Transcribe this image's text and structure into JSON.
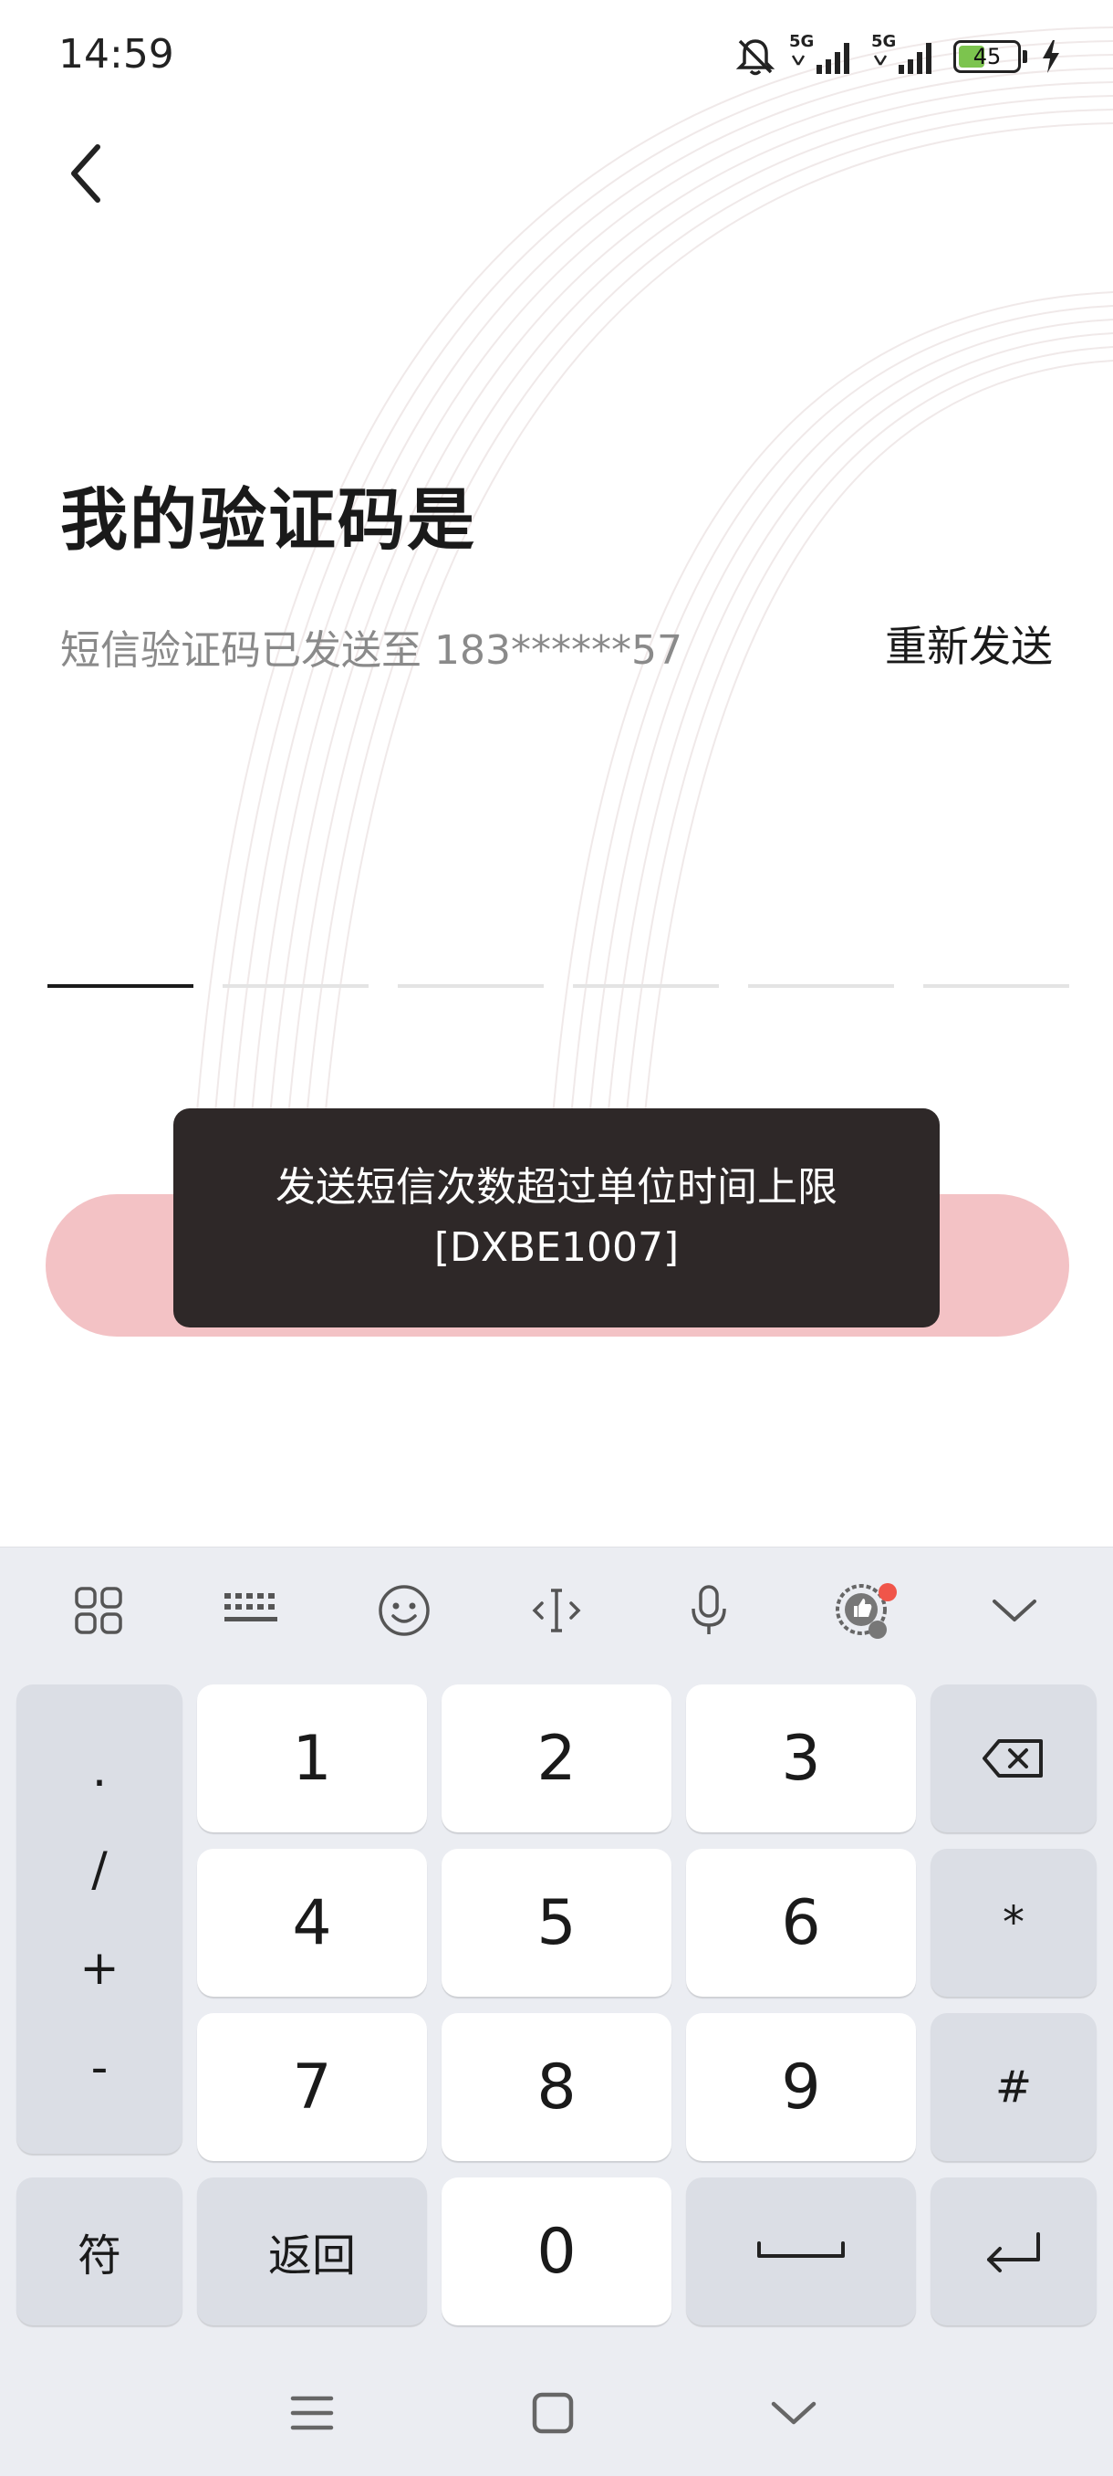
{
  "status_bar": {
    "time": "14:59",
    "signal1_label": "5G",
    "signal2_label": "5G",
    "battery_level": "45",
    "battery_fraction": 0.45,
    "battery_color": "#7cc44e",
    "icons": [
      "bell-muted-icon",
      "signal-icon",
      "signal-icon",
      "battery-icon",
      "charging-bolt-icon"
    ]
  },
  "header": {
    "back_icon": "chevron-left-icon"
  },
  "main": {
    "title": "我的验证码是",
    "sms_hint": "短信验证码已发送至 183******57",
    "resend_label": "重新发送",
    "code_slots": 6,
    "submit_color": "#f3c2c5"
  },
  "toast": {
    "line1": "发送短信次数超过单位时间上限",
    "line2": "[DXBE1007]"
  },
  "keyboard": {
    "toolbar_icons": [
      "grid-apps-icon",
      "keyboard-icon",
      "emoji-icon",
      "text-cursor-icon",
      "microphone-icon",
      "ad-badge-icon",
      "chevron-down-icon"
    ],
    "symbols": [
      ".",
      "/",
      "+",
      "-"
    ],
    "digits": [
      "1",
      "2",
      "3",
      "4",
      "5",
      "6",
      "7",
      "8",
      "9",
      "0"
    ],
    "star_label": "*",
    "hash_label": "#",
    "sym_key_label": "符",
    "back_key_label": "返回",
    "backspace_icon": "backspace-icon",
    "space_icon": "space-icon",
    "enter_icon": "enter-icon"
  },
  "nav_bar": {
    "icons": [
      "menu-icon",
      "home-square-icon",
      "back-chevron-down-icon"
    ]
  }
}
